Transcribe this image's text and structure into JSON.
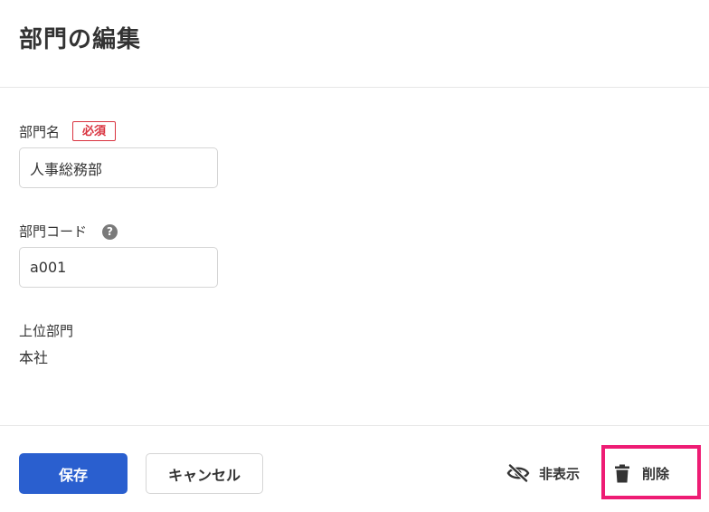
{
  "page": {
    "title": "部門の編集"
  },
  "form": {
    "department_name": {
      "label": "部門名",
      "required_badge": "必須",
      "value": "人事総務部"
    },
    "department_code": {
      "label": "部門コード",
      "help_icon": "?",
      "value": "a001"
    },
    "parent_department": {
      "label": "上位部門",
      "value": "本社"
    }
  },
  "footer": {
    "save_label": "保存",
    "cancel_label": "キャンセル",
    "hide_label": "非表示",
    "delete_label": "削除"
  },
  "icons": {
    "hide": "eye-off-icon",
    "delete": "trash-icon",
    "help": "question-circle-icon"
  },
  "colors": {
    "primary": "#2a5fcf",
    "required": "#d9333f",
    "highlight": "#ee1c74"
  }
}
